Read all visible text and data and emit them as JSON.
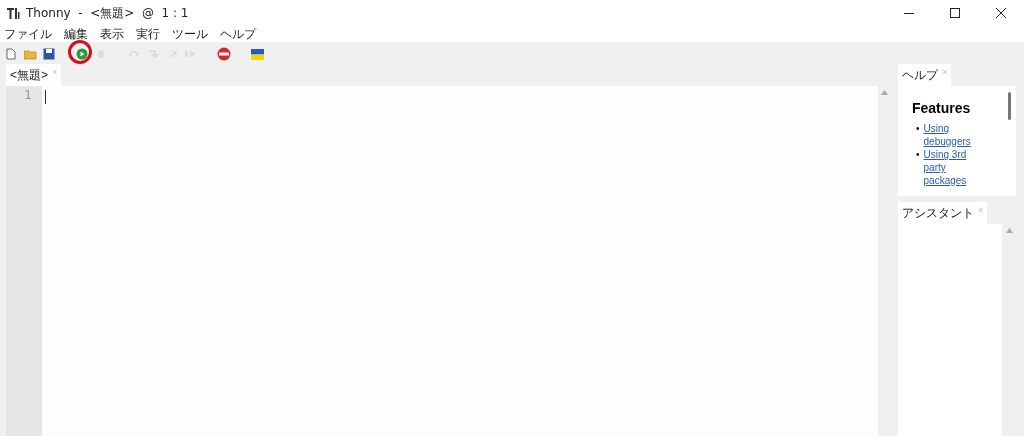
{
  "window": {
    "title": "Thonny  -  <無題>  @  1 : 1"
  },
  "menu": [
    "ファイル",
    "編集",
    "表示",
    "実行",
    "ツール",
    "ヘルプ"
  ],
  "toolbar": [
    {
      "kind": "new",
      "disabled": false,
      "highlighted": false
    },
    {
      "kind": "open",
      "disabled": false,
      "highlighted": false
    },
    {
      "kind": "save",
      "disabled": false,
      "highlighted": false
    },
    {
      "kind": "run",
      "disabled": false,
      "highlighted": true
    },
    {
      "kind": "debug",
      "disabled": true,
      "highlighted": false
    },
    {
      "kind": "step-over",
      "disabled": true,
      "highlighted": false
    },
    {
      "kind": "step-into",
      "disabled": true,
      "highlighted": false
    },
    {
      "kind": "step-out",
      "disabled": true,
      "highlighted": false
    },
    {
      "kind": "resume",
      "disabled": true,
      "highlighted": false
    },
    {
      "kind": "stop",
      "disabled": false,
      "highlighted": false
    },
    {
      "kind": "flag",
      "disabled": false,
      "highlighted": false
    }
  ],
  "editor": {
    "tab": {
      "label": "<無題>",
      "close": "×"
    },
    "line_numbers": [
      "1"
    ]
  },
  "help": {
    "tab": {
      "label": "ヘルプ",
      "close": "×"
    },
    "heading": "Features",
    "links": [
      {
        "bullet": "•",
        "text": "Using debuggers"
      },
      {
        "bullet": "•",
        "text": "Using 3rd party packages"
      }
    ]
  },
  "assistant": {
    "tab": {
      "label": "アシスタント",
      "close": "×"
    }
  }
}
